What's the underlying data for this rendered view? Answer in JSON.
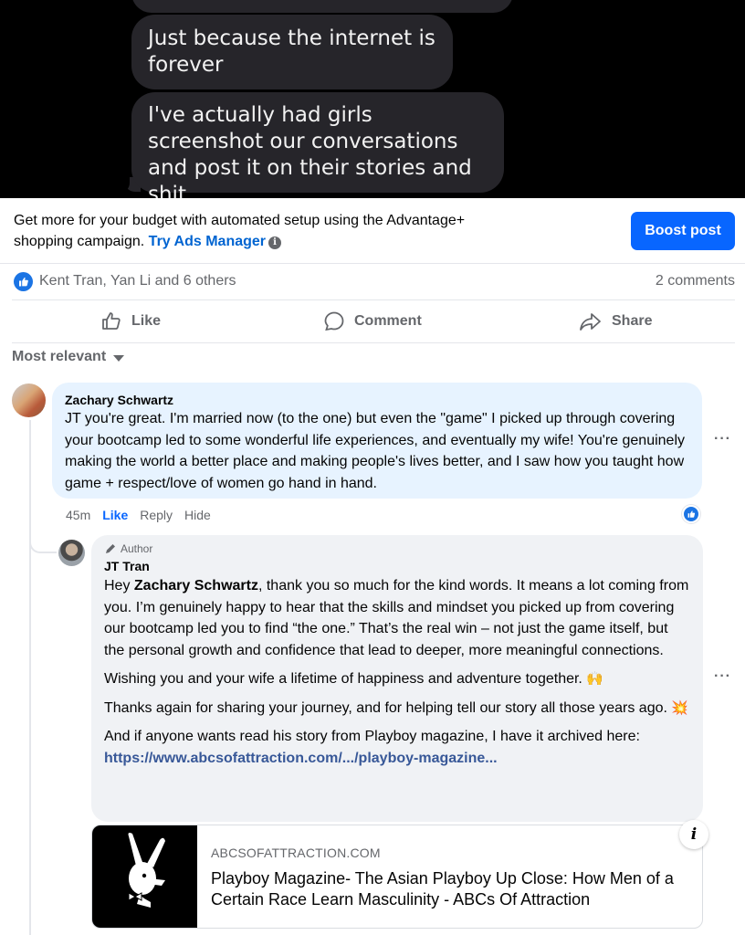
{
  "sms_image": {
    "partial_message": "...",
    "messages": [
      "Just because the internet is forever",
      "I've actually had girls screenshot our conversations and post it on their stories and shit"
    ]
  },
  "boost": {
    "text": "Get more for your budget with automated setup using the Advantage+ shopping campaign.",
    "link": "Try Ads Manager",
    "info_icon": "info-icon",
    "button": "Boost post"
  },
  "reactions": {
    "icon": "like-reaction-icon",
    "names": "Kent Tran, Yan Li and 6 others",
    "comments_count": "2 comments"
  },
  "actions": {
    "like": "Like",
    "comment": "Comment",
    "share": "Share"
  },
  "sort": {
    "label": "Most relevant"
  },
  "comments": [
    {
      "author": "Zachary Schwartz",
      "text": "JT you're great. I'm married now (to the one) but even the \"game\" I picked up through covering your bootcamp led to some wonderful life experiences, and eventually my wife! You're genuinely making the world a better place and making people's lives better, and I saw how you taught how game + respect/love of women go hand in hand.",
      "time": "45m",
      "like": "Like",
      "reply": "Reply",
      "hide": "Hide",
      "more": "···"
    }
  ],
  "reply": {
    "badge": "Author",
    "author": "JT Tran",
    "greeting": "Hey",
    "mention": "Zachary Schwartz",
    "p1_rest": ", thank you so much for the kind words. It means a lot coming from you. I’m genuinely happy to hear that the skills and mindset you picked up from covering our bootcamp led you to find “the one.” That’s the real win – not just the game itself, but the personal growth and confidence that lead to deeper, more meaningful connections.",
    "p2": "Wishing you and your wife a lifetime of happiness and adventure together.",
    "p2_emoji": "🙌",
    "p3": "Thanks again for sharing your journey, and for helping tell our story all those years ago.",
    "p3_emoji": "💥",
    "p4": "And if anyone wants read his story from Playboy magazine, I have it archived here:",
    "link": "https://www.abcsofattraction.com/.../playboy-magazine...",
    "more": "···"
  },
  "preview": {
    "domain": "ABCSOFATTRACTION.COM",
    "title": "Playboy Magazine- The Asian Playboy Up Close: How Men of a Certain Race Learn Masculinity - ABCs Of Attraction",
    "info": "i"
  },
  "colors": {
    "accent": "#0866ff",
    "link": "#385898",
    "highlight_bubble": "#e7f3ff",
    "bubble": "#f0f2f5",
    "secondary_text": "#65676b"
  }
}
